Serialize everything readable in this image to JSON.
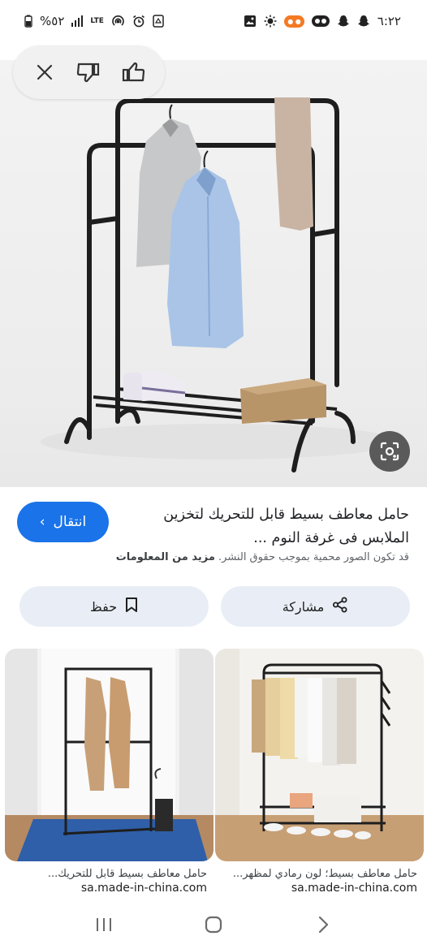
{
  "status_bar": {
    "time": "٦:٢٢",
    "battery": "%٥٢",
    "network": "LTE",
    "icons_left": [
      "battery-icon",
      "signal-icon",
      "lte-icon",
      "hotspot-icon",
      "alarm-icon",
      "recycle-icon"
    ],
    "icons_right": [
      "gallery-icon",
      "brightness-icon",
      "orange-app-icon",
      "app-badge-icon",
      "snapchat-icon",
      "snapchat-icon"
    ]
  },
  "feedback_bar": {
    "icons": [
      "close-icon",
      "thumb-down-icon",
      "thumb-up-icon"
    ]
  },
  "hero": {
    "lens_icon": "lens-icon"
  },
  "result": {
    "visit_label": "انتقال",
    "title_line1": "حامل معاطف بسيط قابل للتحريك لتخزين",
    "title_line2": "الملابس فى غرفة النوم ...",
    "copyright_text": "قد تكون الصور محمية بموجب حقوق النشر.",
    "more_info": "مزيد من المعلومات"
  },
  "actions": {
    "share_label": "مشاركة",
    "save_label": "حفظ"
  },
  "related": [
    {
      "title": "حامل معاطف بسيط؛ لون رمادي لمظهر...",
      "source": "sa.made-in-china.com"
    },
    {
      "title": "حامل معاطف بسيط قابل للتحريك...",
      "source": "sa.made-in-china.com"
    }
  ],
  "colors": {
    "accent": "#1a73e8",
    "action_bg": "#e9eef6"
  }
}
